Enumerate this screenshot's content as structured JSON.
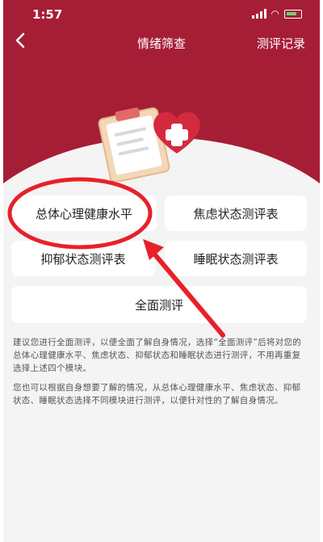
{
  "status_bar": {
    "time": "1:57"
  },
  "nav": {
    "back_icon": "chevron-left-icon",
    "title": "情绪筛查",
    "right_label": "测评记录"
  },
  "illustration": {
    "icons": [
      "clipboard-icon",
      "heart-plus-icon"
    ]
  },
  "buttons": {
    "overall": "总体心理健康水平",
    "anxiety": "焦虑状态测评表",
    "depression": "抑郁状态测评表",
    "sleep": "睡眠状态测评表",
    "full": "全面测评"
  },
  "description": {
    "p1": "建议您进行全面测评，以便全面了解自身情况，选择“全面测评”后将对您的总体心理健康水平、焦虑状态、抑郁状态和睡眠状态进行测评，不用再重复选择上述四个模块。",
    "p2": "您也可以根据自身想要了解的情况，从总体心理健康水平、焦虑状态、抑郁状态、睡眠状态选择不同模块进行测评，以便针对性的了解自身情况。"
  },
  "colors": {
    "header": "#a61e36",
    "annotation": "#e8202a",
    "background": "#f4f4f4"
  }
}
